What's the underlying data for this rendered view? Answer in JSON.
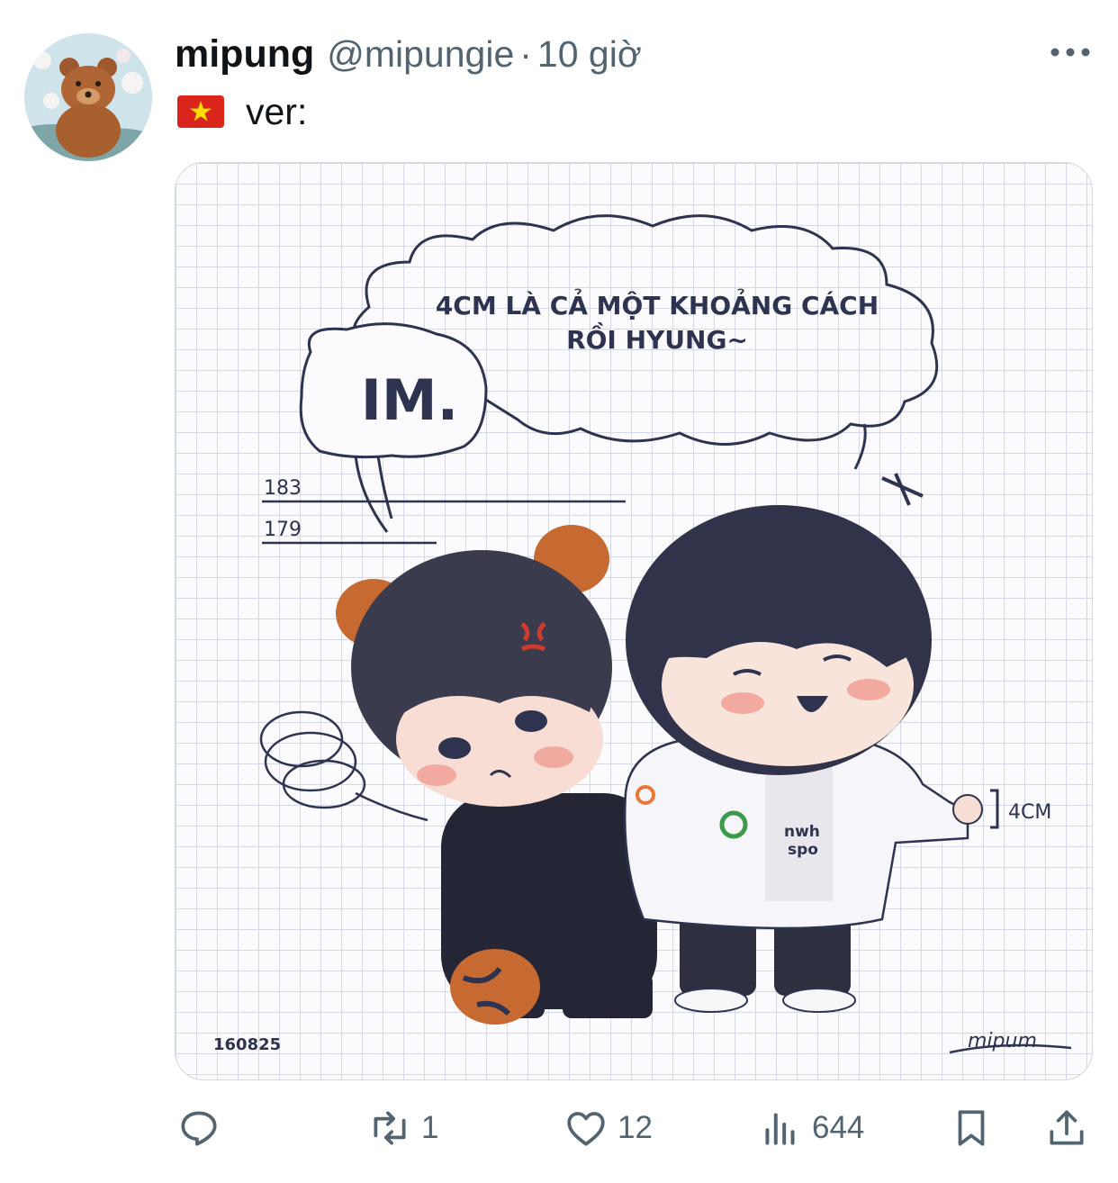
{
  "tweet": {
    "display_name": "mipung",
    "handle": "@mipungie",
    "separator": "·",
    "time": "10 giờ",
    "text": "ver:"
  },
  "image": {
    "bubble_big_line1": "4CM LÀ CẢ MỘT KHOẢNG CÁCH",
    "bubble_big_line2": "RỒI HYUNG~",
    "bubble_small": "IM.",
    "height_mark_1": "183",
    "height_mark_2": "179",
    "diff_label": "4CM",
    "date_sig": "160825",
    "artist_sig": "mipum",
    "shirt_text_1": "nwh",
    "shirt_text_2": "spo"
  },
  "actions": {
    "reply_count": "",
    "retweet_count": "1",
    "like_count": "12",
    "views_count": "644"
  },
  "icons": [
    "avatar-bear",
    "vietnam-flag-icon",
    "more-icon",
    "reply-icon",
    "retweet-icon",
    "like-icon",
    "views-icon",
    "bookmark-icon",
    "share-icon"
  ],
  "colors": {
    "text": "#0f1419",
    "secondary": "#536471",
    "border": "#cfd9de",
    "grid": "#d4d8e8",
    "ink": "#2e3350"
  }
}
